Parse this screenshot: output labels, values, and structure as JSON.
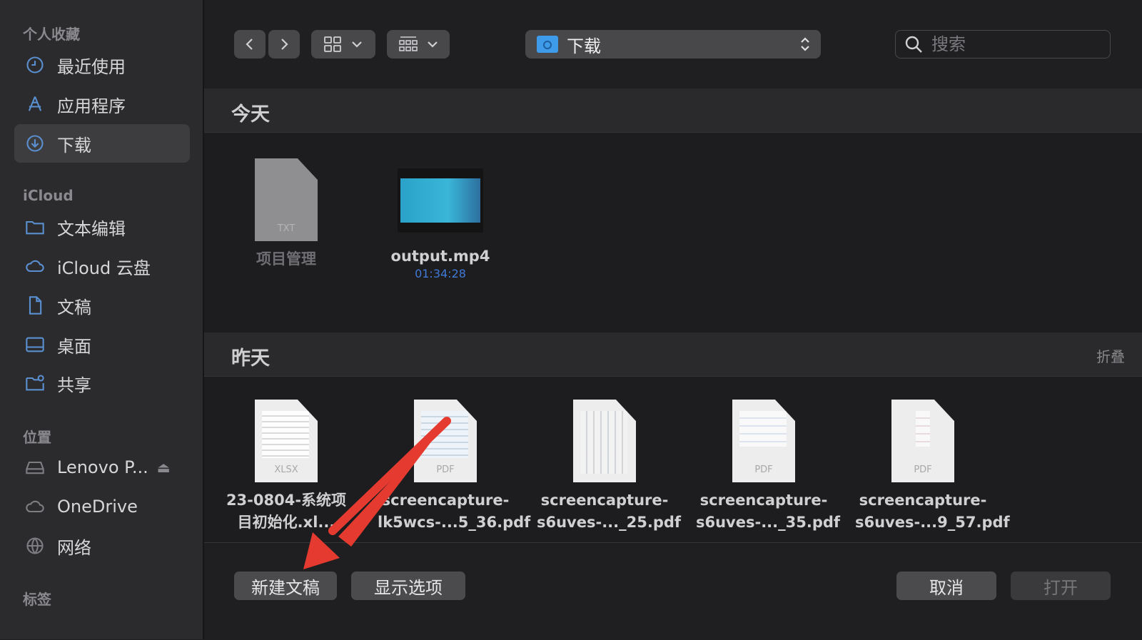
{
  "sidebar": {
    "favorites_header": "个人收藏",
    "favorites": [
      {
        "label": "最近使用",
        "icon": "clock-icon"
      },
      {
        "label": "应用程序",
        "icon": "apps-icon"
      },
      {
        "label": "下载",
        "icon": "download-icon"
      }
    ],
    "icloud_header": "iCloud",
    "icloud": [
      {
        "label": "文本编辑",
        "icon": "folder-icon"
      },
      {
        "label": "iCloud 云盘",
        "icon": "cloud-icon"
      },
      {
        "label": "文稿",
        "icon": "document-icon"
      },
      {
        "label": "桌面",
        "icon": "desktop-icon"
      },
      {
        "label": "共享",
        "icon": "shared-folder-icon"
      }
    ],
    "locations_header": "位置",
    "locations": [
      {
        "label": "Lenovo P...",
        "icon": "drive-icon"
      },
      {
        "label": "OneDrive",
        "icon": "cloud-icon"
      },
      {
        "label": "网络",
        "icon": "globe-icon"
      }
    ],
    "tags_header": "标签"
  },
  "toolbar": {
    "location": "下载",
    "search_placeholder": "搜索"
  },
  "sections": {
    "today": "今天",
    "yesterday": "昨天",
    "collapse": "折叠"
  },
  "today_files": [
    {
      "name": "项目管理",
      "ext": "TXT"
    },
    {
      "name": "output.mp4",
      "sub": "01:34:28"
    }
  ],
  "yesterday_files": [
    {
      "name1": "23-0804-系统项",
      "name2": "目初始化.xl...",
      "ext": "XLSX"
    },
    {
      "name1": "screencapture-",
      "name2": "lk5wcs-...5_36.pdf",
      "ext": "PDF"
    },
    {
      "name1": "screencapture-",
      "name2": "s6uves-..._25.pdf",
      "ext": ""
    },
    {
      "name1": "screencapture-",
      "name2": "s6uves-..._35.pdf",
      "ext": "PDF"
    },
    {
      "name1": "screencapture-",
      "name2": "s6uves-...9_57.pdf",
      "ext": "PDF"
    }
  ],
  "buttons": {
    "new_document": "新建文稿",
    "show_options": "显示选项",
    "cancel": "取消",
    "open": "打开"
  },
  "colors": {
    "accent": "#3d9be9",
    "arrow": "#e53a2f"
  }
}
